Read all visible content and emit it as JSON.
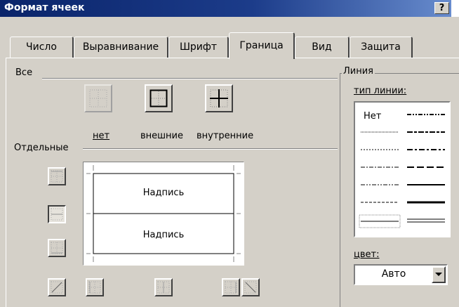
{
  "window": {
    "title": "Формат ячеек",
    "help_label": "?"
  },
  "tabs": [
    {
      "label": "Число",
      "active": false
    },
    {
      "label": "Выравнивание",
      "active": false
    },
    {
      "label": "Шрифт",
      "active": false
    },
    {
      "label": "Граница",
      "active": true
    },
    {
      "label": "Вид",
      "active": false
    },
    {
      "label": "Защита",
      "active": false
    }
  ],
  "presets": {
    "group_label": "Все",
    "none_label": "нет",
    "outline_label": "внешние",
    "inside_label": "внутренние"
  },
  "border": {
    "group_label": "Отдельные",
    "preview_text_top": "Надпись",
    "preview_text_bottom": "Надпись"
  },
  "line": {
    "group_label": "Линия",
    "style_label": "тип линии:",
    "none_label": "Нет",
    "color_label": "цвет:",
    "color_value": "Авто"
  },
  "colors": {
    "titlebar": "#0a246a",
    "face": "#d4d0c8",
    "shadow": "#808080"
  }
}
